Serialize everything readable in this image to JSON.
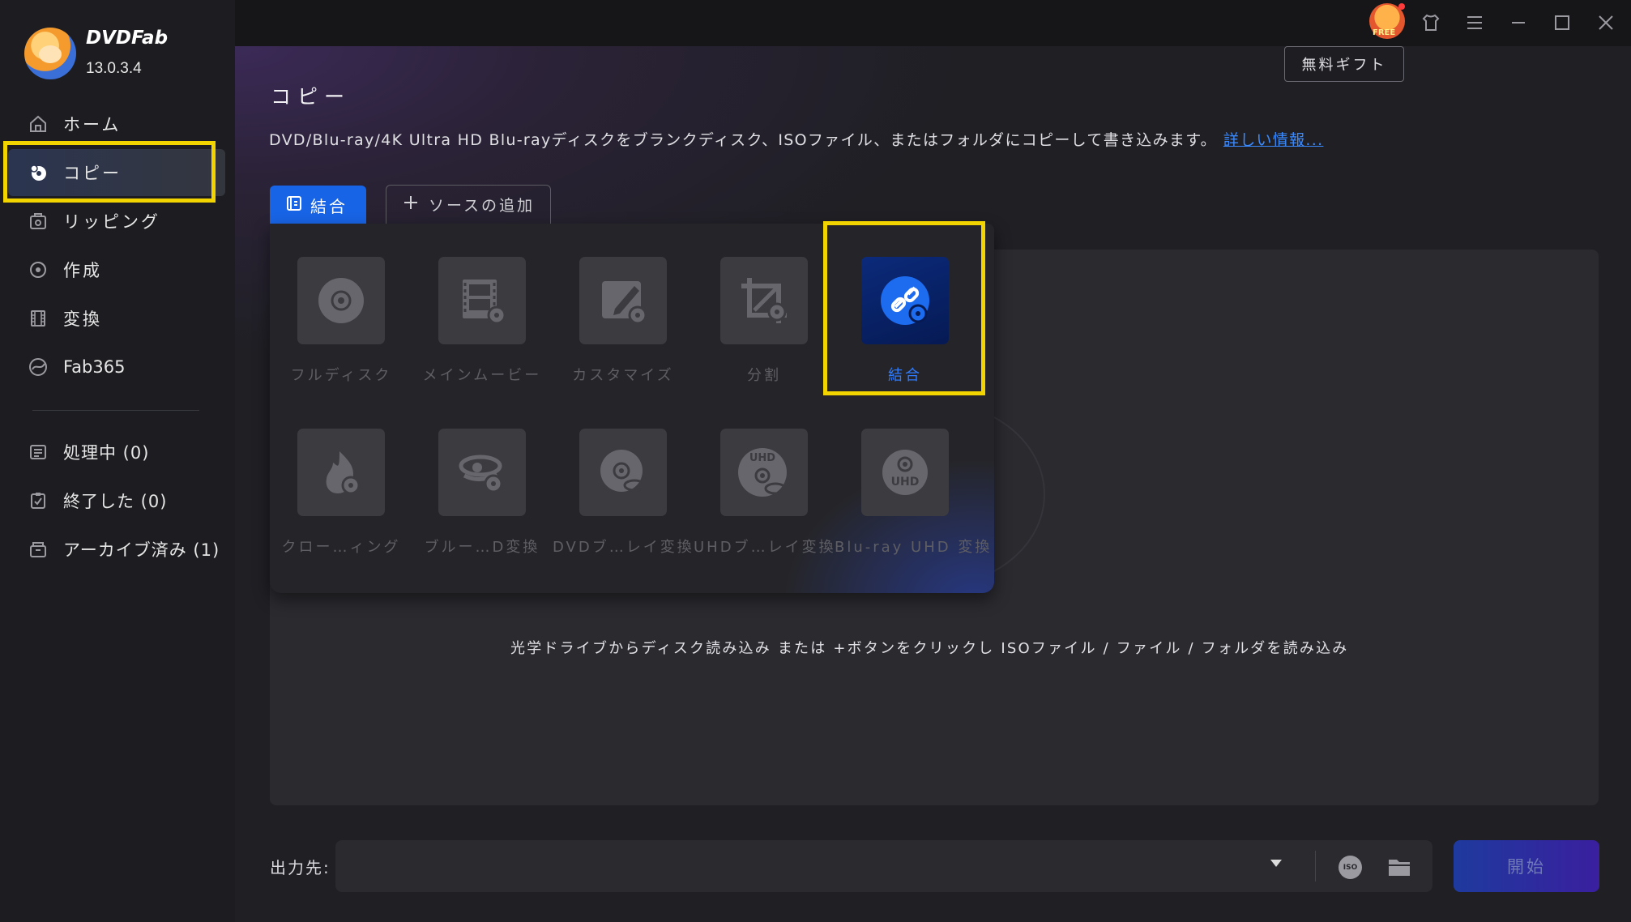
{
  "app": {
    "name": "DVDFab",
    "version": "13.0.3.4"
  },
  "sidebar": {
    "items": [
      {
        "label": "ホーム",
        "icon": "home-icon"
      },
      {
        "label": "コピー",
        "icon": "copy-disc-icon",
        "active": true
      },
      {
        "label": "リッピング",
        "icon": "ripper-icon"
      },
      {
        "label": "作成",
        "icon": "creator-icon"
      },
      {
        "label": "変換",
        "icon": "converter-icon"
      },
      {
        "label": "Fab365",
        "icon": "fab365-icon"
      }
    ],
    "status_items": [
      {
        "label": "処理中 (0)",
        "icon": "processing-icon"
      },
      {
        "label": "終了した (0)",
        "icon": "finished-icon"
      },
      {
        "label": "アーカイブ済み (1)",
        "icon": "archive-icon"
      }
    ]
  },
  "topbar": {
    "free_badge": "FREE",
    "icons": [
      "free-gift-icon",
      "shirt-skin-icon",
      "menu-icon",
      "minimize-icon",
      "maximize-icon",
      "close-icon"
    ]
  },
  "main": {
    "gift_button": "無料ギフト",
    "title": "コピー",
    "description": "DVD/Blu-ray/4K Ultra HD Blu-rayディスクをブランクディスク、ISOファイル、またはフォルダにコピーして書き込みます。",
    "more_link": "詳しい情報...",
    "mode_button": "結合",
    "add_source_button": "ソースの追加",
    "drop_hint": "光学ドライブからディスク読み込み または +ボタンをクリックし ISOファイル / ファイル / フォルダを読み込み"
  },
  "modes": [
    {
      "label": "フルディスク",
      "icon": "full-disc-icon"
    },
    {
      "label": "メインムービー",
      "icon": "main-movie-icon"
    },
    {
      "label": "カスタマイズ",
      "icon": "customize-icon"
    },
    {
      "label": "分割",
      "icon": "split-icon"
    },
    {
      "label": "結合",
      "icon": "merge-icon",
      "selected": true
    },
    {
      "label": "クロー…ィング",
      "icon": "clone-burn-icon"
    },
    {
      "label": "ブルー…D変換",
      "icon": "bluray-to-dvd-icon"
    },
    {
      "label": "DVDブ…レイ変換",
      "icon": "dvd-to-bluray-icon"
    },
    {
      "label": "UHDブ…レイ変換",
      "icon": "uhd-to-bluray-icon"
    },
    {
      "label": "Blu-ray UHD 変換",
      "icon": "bluray-to-uhd-icon"
    }
  ],
  "output": {
    "label": "出力先:",
    "value": "",
    "start_button": "開始"
  },
  "colors": {
    "accent": "#1864e6",
    "highlight": "#f2d400",
    "selected_label": "#2f7cff"
  }
}
